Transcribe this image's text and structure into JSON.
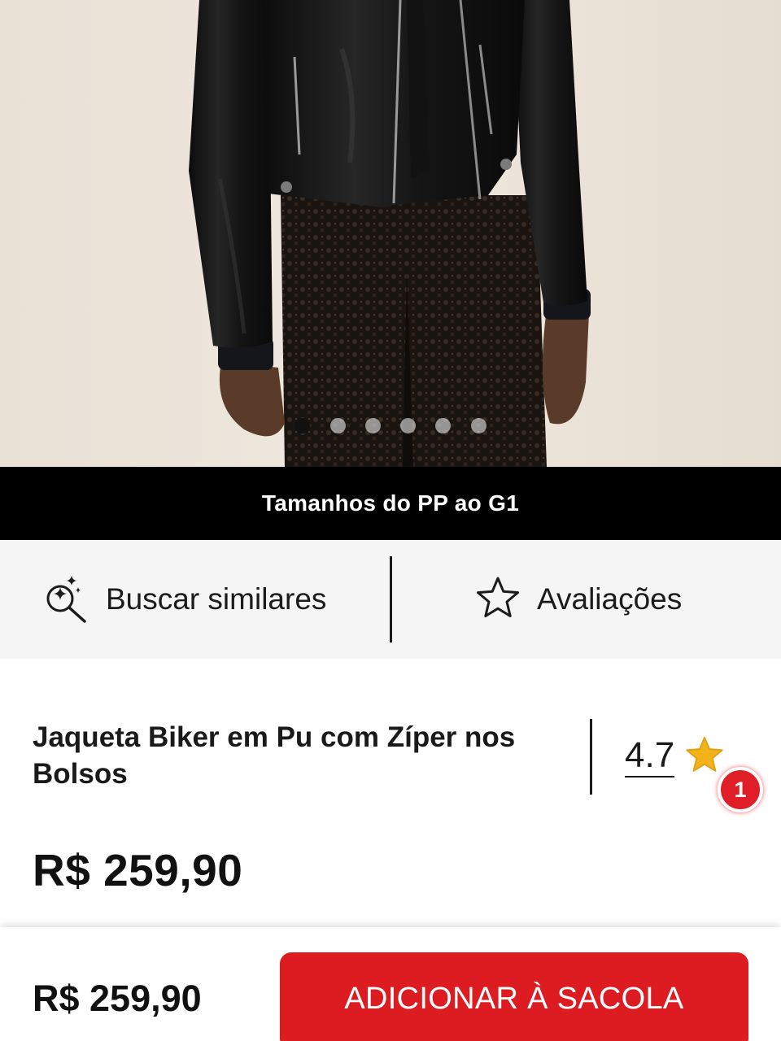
{
  "product": {
    "image_alt": "Jaqueta Biker em Pu com Zíper nos Bolsos",
    "carousel": {
      "total": 6,
      "active_index": 0
    },
    "sizes_banner": "Tamanhos do PP ao G1",
    "title": "Jaqueta Biker em Pu com Zíper nos Bolsos",
    "rating": "4.7",
    "price": "R$ 259,90"
  },
  "actions": {
    "similar_label": "Buscar similares",
    "reviews_label": "Avaliações"
  },
  "notification_badge": "1",
  "bottom_bar": {
    "price": "R$ 259,90",
    "add_to_bag_label": "ADICIONAR À SACOLA"
  },
  "colors": {
    "accent_red": "#dd1c22",
    "banner_black": "#000000",
    "star_gold": "#f2b21a"
  },
  "icons": {
    "similar": "sparkle-search-icon",
    "reviews": "star-outline-icon",
    "rating": "star-filled-icon"
  }
}
